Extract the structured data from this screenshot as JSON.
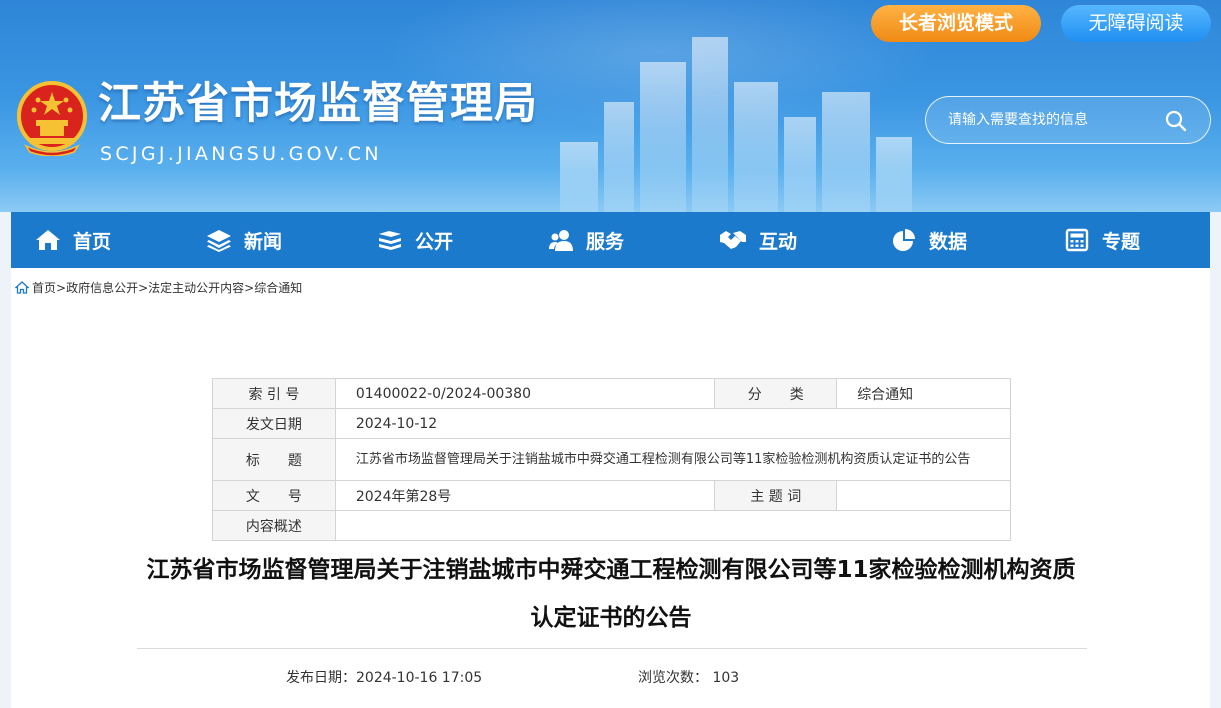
{
  "header": {
    "title": "江苏省市场监督管理局",
    "domain": "SCJGJ.JIANGSU.GOV.CN",
    "elder_mode_label": "长者浏览模式",
    "accessible_label": "无障碍阅读",
    "search_placeholder": "请输入需要查找的信息"
  },
  "nav": [
    {
      "label": "首页",
      "icon": "home-icon"
    },
    {
      "label": "新闻",
      "icon": "layers-icon"
    },
    {
      "label": "公开",
      "icon": "book-icon"
    },
    {
      "label": "服务",
      "icon": "users-icon"
    },
    {
      "label": "互动",
      "icon": "handshake-icon"
    },
    {
      "label": "数据",
      "icon": "pie-chart-icon"
    },
    {
      "label": "专题",
      "icon": "calculator-icon"
    }
  ],
  "breadcrumb": [
    "首页",
    "政府信息公开",
    "法定主动公开内容",
    "综合通知"
  ],
  "meta": {
    "index_label": "索 引 号",
    "index_value": "01400022-0/2024-00380",
    "category_label": "分　　类",
    "category_value": "综合通知",
    "date_label": "发文日期",
    "date_value": "2024-10-12",
    "title_label": "标　　题",
    "title_value": "江苏省市场监督管理局关于注销盐城市中舜交通工程检测有限公司等11家检验检测机构资质认定证书的公告",
    "docno_label": "文　　号",
    "docno_value": "2024年第28号",
    "subject_label": "主 题 词",
    "subject_value": "",
    "summary_label": "内容概述",
    "summary_value": ""
  },
  "article": {
    "title": "江苏省市场监督管理局关于注销盐城市中舜交通工程检测有限公司等11家检验检测机构资质认定证书的公告",
    "publish_label": "发布日期：",
    "publish_value": "2024-10-16 17:05",
    "views_label": "浏览次数：",
    "views_value": "103"
  }
}
